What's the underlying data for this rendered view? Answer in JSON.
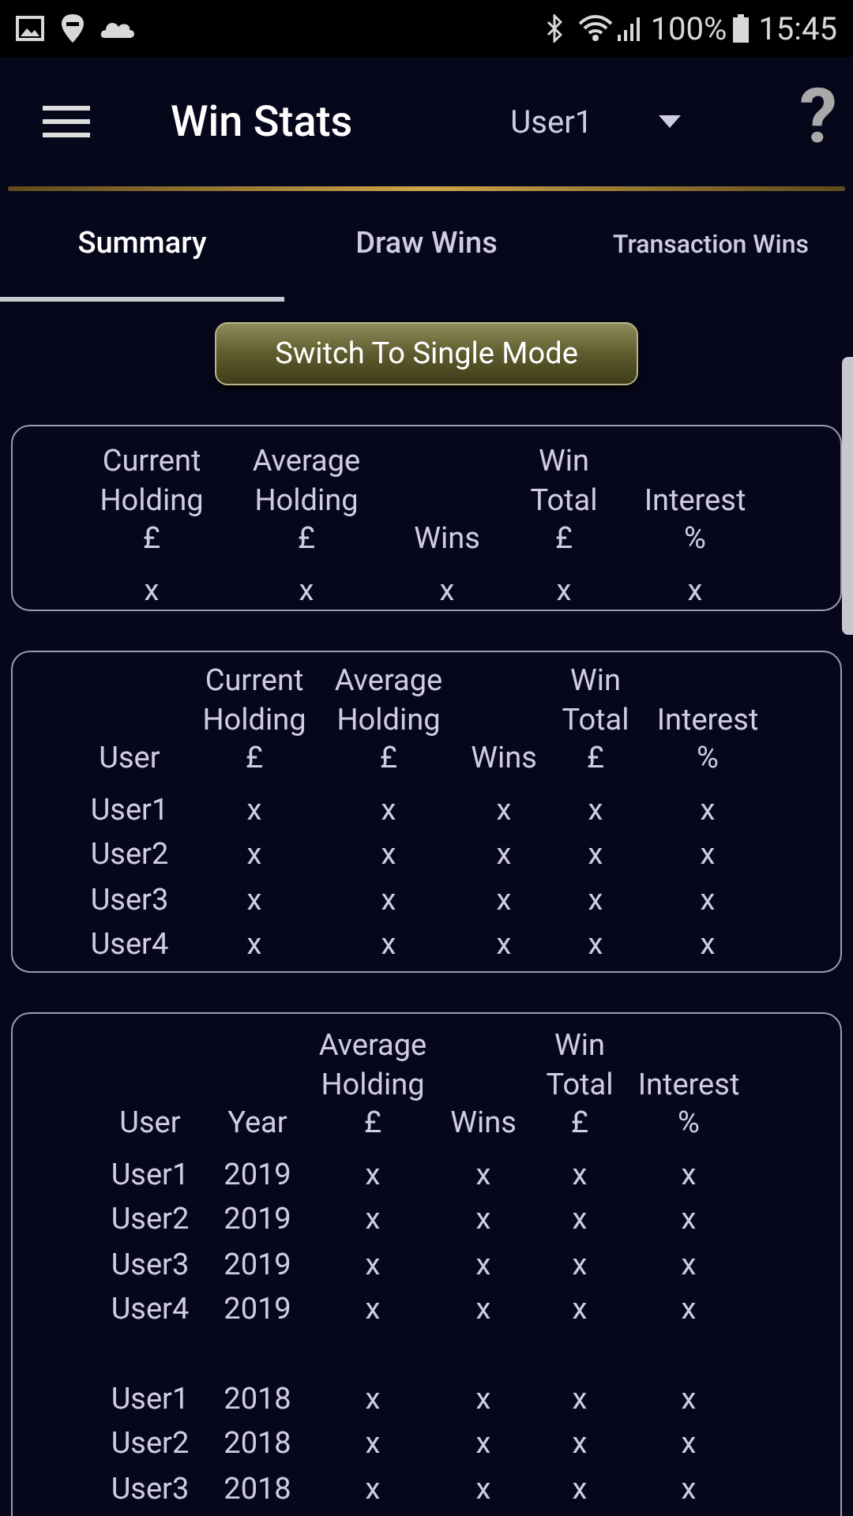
{
  "status_bar": {
    "battery": "100%",
    "time": "15:45"
  },
  "app_bar": {
    "title": "Win Stats",
    "user": "User1",
    "help": "?"
  },
  "tabs": [
    {
      "label": "Summary",
      "selected": true
    },
    {
      "label": "Draw Wins",
      "selected": false
    },
    {
      "label": "Transaction Wins",
      "selected": false
    }
  ],
  "mode_button": "Switch To Single Mode",
  "tables": [
    {
      "columns": [
        "Current\nHolding\n£",
        "Average\nHolding\n£",
        "Wins",
        "Win\nTotal\n£",
        "Interest\n%"
      ],
      "groups": [
        {
          "rows": [
            [
              "x",
              "x",
              "x",
              "x",
              "x"
            ]
          ]
        }
      ]
    },
    {
      "columns": [
        "User",
        "Current\nHolding\n£",
        "Average\nHolding\n£",
        "Wins",
        "Win\nTotal\n£",
        "Interest\n%"
      ],
      "groups": [
        {
          "rows": [
            [
              "User1",
              "x",
              "x",
              "x",
              "x",
              "x"
            ],
            [
              "User2",
              "x",
              "x",
              "x",
              "x",
              "x"
            ],
            [
              "User3",
              "x",
              "x",
              "x",
              "x",
              "x"
            ],
            [
              "User4",
              "x",
              "x",
              "x",
              "x",
              "x"
            ]
          ]
        }
      ]
    },
    {
      "columns": [
        "User",
        "Year",
        "Average\nHolding\n£",
        "Wins",
        "Win\nTotal\n£",
        "Interest\n%"
      ],
      "groups": [
        {
          "rows": [
            [
              "User1",
              "2019",
              "x",
              "x",
              "x",
              "x"
            ],
            [
              "User2",
              "2019",
              "x",
              "x",
              "x",
              "x"
            ],
            [
              "User3",
              "2019",
              "x",
              "x",
              "x",
              "x"
            ],
            [
              "User4",
              "2019",
              "x",
              "x",
              "x",
              "x"
            ]
          ]
        },
        {
          "rows": [
            [
              "User1",
              "2018",
              "x",
              "x",
              "x",
              "x"
            ],
            [
              "User2",
              "2018",
              "x",
              "x",
              "x",
              "x"
            ],
            [
              "User3",
              "2018",
              "x",
              "x",
              "x",
              "x"
            ]
          ]
        }
      ]
    }
  ]
}
